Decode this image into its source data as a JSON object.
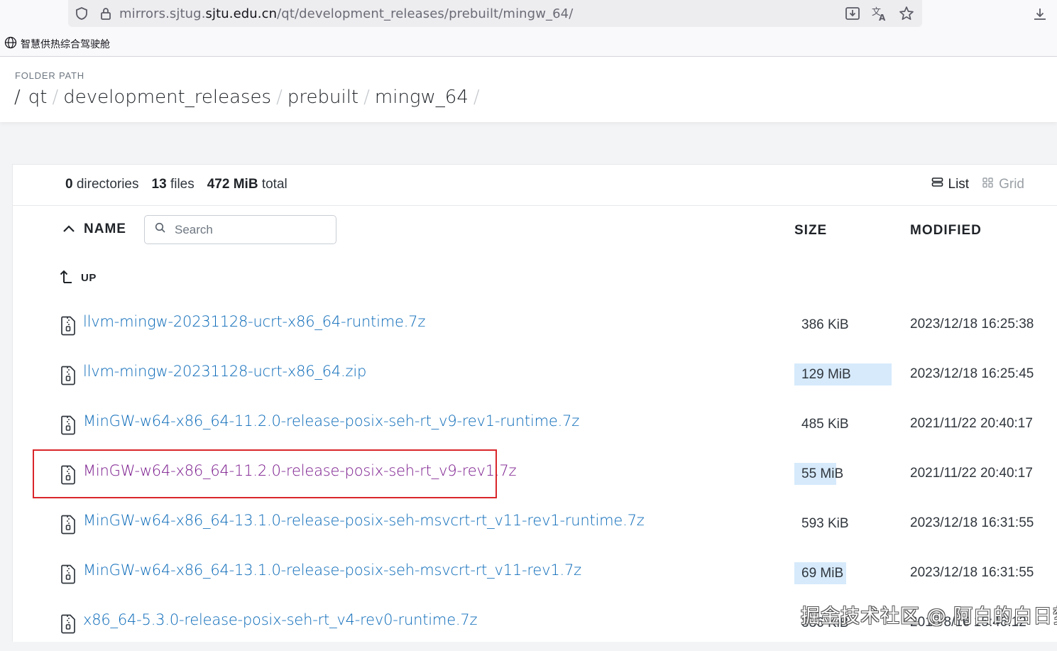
{
  "browser": {
    "url_prefix": "mirrors.sjtug.",
    "url_domain": "sjtu.edu.cn",
    "url_path": "/qt/development_releases/prebuilt/mingw_64/",
    "bookmark_label": "智慧供热综合驾驶舱",
    "icons": [
      "shield-icon",
      "lock-icon",
      "save-page-icon",
      "translate-icon",
      "star-icon",
      "download-icon",
      "globe-icon"
    ]
  },
  "header": {
    "folder_label": "FOLDER PATH",
    "crumbs": [
      "qt",
      "development_releases",
      "prebuilt",
      "mingw_64"
    ],
    "separator": "/"
  },
  "summary": {
    "dirs_count": "0",
    "dirs_label": "directories",
    "files_count": "13",
    "files_label": "files",
    "total_size": "472 MiB",
    "total_label": "total"
  },
  "view": {
    "list_label": "List",
    "grid_label": "Grid",
    "active": "list"
  },
  "columns": {
    "name": "NAME",
    "size": "SIZE",
    "modified": "MODIFIED"
  },
  "search": {
    "placeholder": "Search",
    "value": ""
  },
  "up_label": "UP",
  "files": [
    {
      "name": "llvm-mingw-20231128-ucrt-x86_64-runtime.7z",
      "size": "386 KiB",
      "size_fraction": 0.0,
      "modified": "2023/12/18 16:25:38",
      "visited": false
    },
    {
      "name": "llvm-mingw-20231128-ucrt-x86_64.zip",
      "size": "129 MiB",
      "size_fraction": 1.0,
      "modified": "2023/12/18 16:25:45",
      "visited": false
    },
    {
      "name": "MinGW-w64-x86_64-11.2.0-release-posix-seh-rt_v9-rev1-runtime.7z",
      "size": "485 KiB",
      "size_fraction": 0.0,
      "modified": "2021/11/22 20:40:17",
      "visited": false
    },
    {
      "name": "MinGW-w64-x86_64-11.2.0-release-posix-seh-rt_v9-rev1.7z",
      "size": "55 MiB",
      "size_fraction": 0.43,
      "modified": "2021/11/22 20:40:17",
      "visited": true
    },
    {
      "name": "MinGW-w64-x86_64-13.1.0-release-posix-seh-msvcrt-rt_v11-rev1-runtime.7z",
      "size": "593 KiB",
      "size_fraction": 0.0,
      "modified": "2023/12/18 16:31:55",
      "visited": false
    },
    {
      "name": "MinGW-w64-x86_64-13.1.0-release-posix-seh-msvcrt-rt_v11-rev1.7z",
      "size": "69 MiB",
      "size_fraction": 0.53,
      "modified": "2023/12/18 16:31:55",
      "visited": false
    },
    {
      "name": "x86_64-5.3.0-release-posix-seh-rt_v4-rev0-runtime.7z",
      "size": "336 KiB",
      "size_fraction": 0.0,
      "modified": "2018/8/16 15:46:12",
      "visited": false
    }
  ],
  "watermark": "掘金技术社区 @ 阿白的白日梦",
  "colors": {
    "link": "#0969b8",
    "visited_link": "#7a1a8c",
    "size_bar": "#d6eafb",
    "highlight_border": "#d9262b"
  }
}
